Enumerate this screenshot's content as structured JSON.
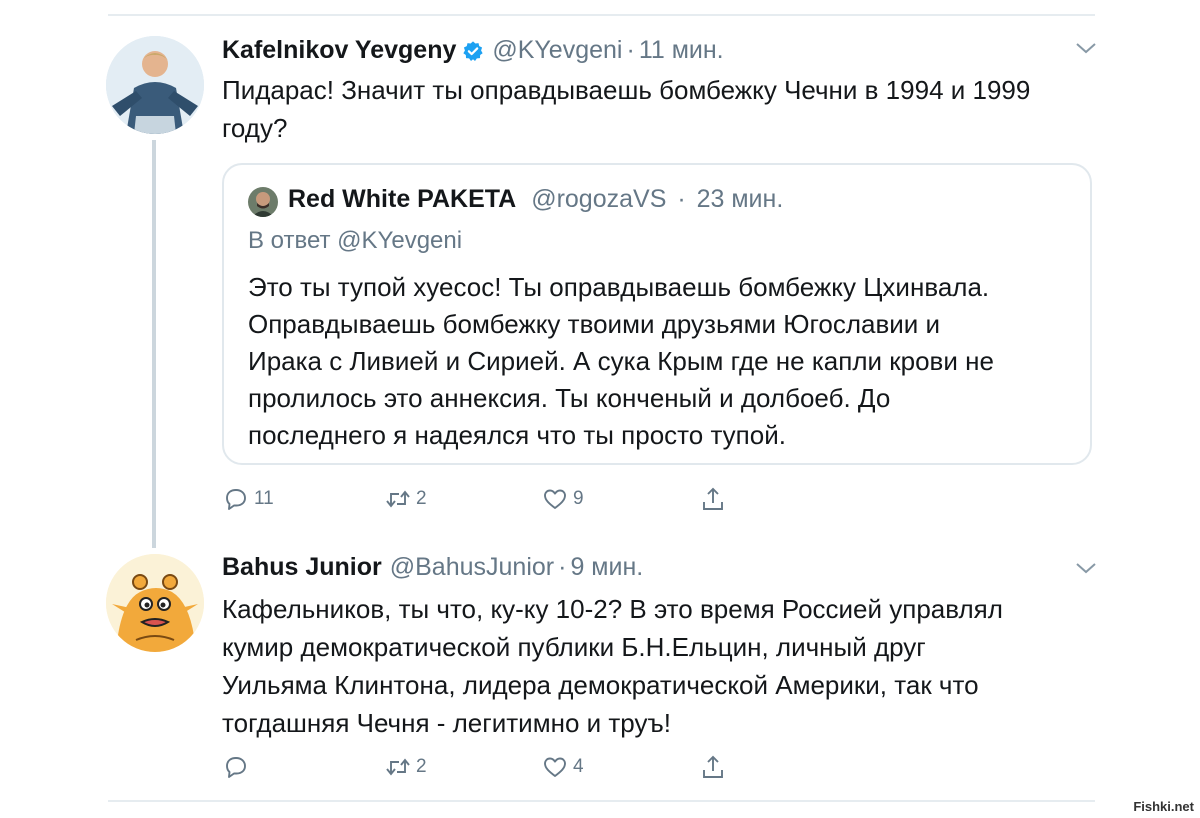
{
  "tweets": [
    {
      "name": "Kafelnikov Yevgeny",
      "handle": "@KYevgeni",
      "dot": "·",
      "time": "11 мин.",
      "text_lines": [
        "Пидарас! Значит ты оправдываешь бомбежку Чечни в 1994 и 1999",
        "году?"
      ],
      "quote": {
        "name": "Red White PAKETA",
        "handle": "@rogozaVS",
        "dot": "·",
        "time": "23 мин.",
        "reply_to": "В ответ @KYevgeni",
        "text_lines": [
          "Это ты тупой хуесос! Ты оправдываешь бомбежку Цхинвала.",
          "Оправдываешь бомбежку твоими друзьями Югославии и",
          "Ирака с Ливией и Сирией. А сука Крым где не капли крови не",
          "пролилось это аннексия. Ты конченый и долбоеб. До",
          "последнего я надеялся что ты просто тупой."
        ]
      },
      "actions": {
        "replies": "11",
        "retweets": "2",
        "likes": "9"
      }
    },
    {
      "name": "Bahus Junior",
      "handle": "@BahusJunior",
      "dot": "·",
      "time": "9 мин.",
      "text_lines": [
        "Кафельников, ты что, ку-ку 10-2? В это время Россией управлял",
        "кумир демократической публики Б.Н.Ельцин, личный друг",
        "Уильяма Клинтона, лидера демократической Америки, так что",
        "тогдашняя Чечня - легитимно и труъ!"
      ],
      "actions": {
        "replies": "",
        "retweets": "2",
        "likes": "4"
      }
    }
  ],
  "icons": {
    "reply": "reply-icon",
    "retweet": "retweet-icon",
    "like": "heart-icon",
    "share": "share-icon",
    "verified": "verified-badge-icon",
    "menu": "chevron-down-icon"
  },
  "colors": {
    "text": "#14171a",
    "secondary": "#657786",
    "verified": "#1da1f2",
    "border": "#e1e8ed"
  },
  "watermark": "Fishki.net"
}
